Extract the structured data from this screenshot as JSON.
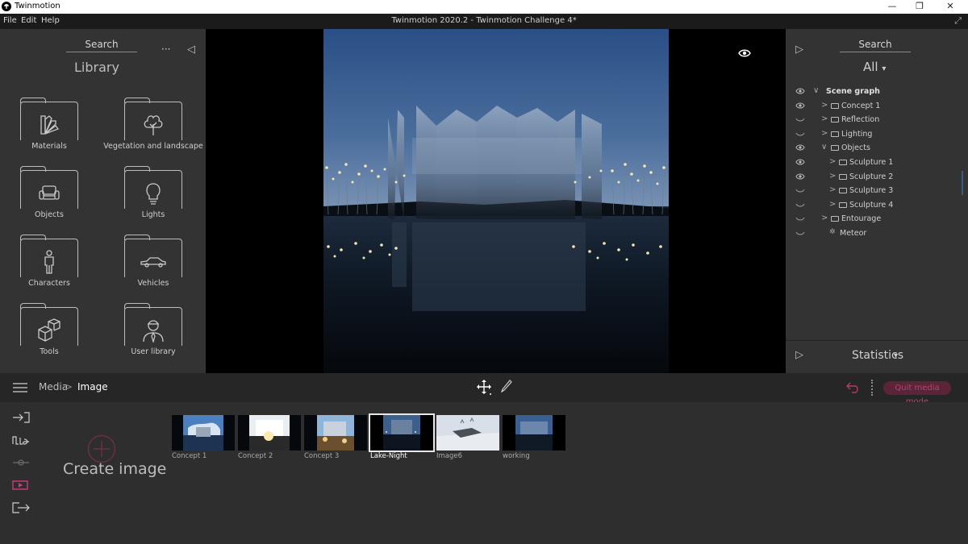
{
  "window": {
    "app_name": "Twinmotion",
    "document_title": "Twinmotion 2020.2 - Twinmotion Challenge 4*",
    "minimize_glyph": "—",
    "maximize_glyph": "❐",
    "close_glyph": "✕"
  },
  "menu": {
    "file": "File",
    "edit": "Edit",
    "help": "Help",
    "expand_glyph": "⤢"
  },
  "library": {
    "search_label": "Search",
    "heading": "Library",
    "more_glyph": "···",
    "collapse_glyph": "◁",
    "items": [
      {
        "label": "Materials",
        "icon": "materials-icon"
      },
      {
        "label": "Vegetation and landscape",
        "icon": "tree-icon"
      },
      {
        "label": "Objects",
        "icon": "sofa-icon"
      },
      {
        "label": "Lights",
        "icon": "lightbulb-icon"
      },
      {
        "label": "Characters",
        "icon": "person-icon"
      },
      {
        "label": "Vehicles",
        "icon": "car-icon"
      },
      {
        "label": "Tools",
        "icon": "cubes-icon"
      },
      {
        "label": "User library",
        "icon": "user-icon"
      }
    ]
  },
  "scene": {
    "expand_glyph": "▷",
    "search_label": "Search",
    "filter_value": "All",
    "filter_caret": "▾",
    "tree": [
      {
        "label": "Scene graph",
        "visible": true,
        "expanded": true,
        "folder": false
      },
      {
        "label": "Concept 1",
        "visible": true,
        "expanded": false,
        "folder": true
      },
      {
        "label": "Reflection",
        "visible": false,
        "expanded": false,
        "folder": true
      },
      {
        "label": "Lighting",
        "visible": false,
        "expanded": false,
        "folder": true
      },
      {
        "label": "Objects",
        "visible": true,
        "expanded": true,
        "folder": true
      },
      {
        "label": "Sculpture 1",
        "visible": true,
        "expanded": false,
        "folder": true
      },
      {
        "label": "Sculpture 2",
        "visible": true,
        "expanded": false,
        "folder": true
      },
      {
        "label": "Sculpture 3",
        "visible": false,
        "expanded": false,
        "folder": true
      },
      {
        "label": "Sculpture 4",
        "visible": false,
        "expanded": false,
        "folder": true
      },
      {
        "label": "Entourage",
        "visible": false,
        "expanded": false,
        "folder": true
      },
      {
        "label": "Meteor",
        "visible": false,
        "expanded": false,
        "folder": false
      }
    ],
    "statistics_label": "Statistics",
    "statistics_caret": "▾"
  },
  "toolbar": {
    "breadcrumb_root": "Media",
    "breadcrumb_separator": ">",
    "breadcrumb_current": "Image",
    "quit_label": "Quit media mode"
  },
  "media": {
    "create_label": "Create image",
    "thumbnails": [
      {
        "label": "Concept 1",
        "selected": false
      },
      {
        "label": "Concept 2",
        "selected": false
      },
      {
        "label": "Concept 3",
        "selected": false
      },
      {
        "label": "Lake-Night",
        "selected": true
      },
      {
        "label": "Image6",
        "selected": false
      },
      {
        "label": "working",
        "selected": false
      }
    ]
  },
  "colors": {
    "panel_bg": "#333333",
    "viewport_bg": "#000000",
    "accent_pink": "#d23a7a",
    "quit_bg": "#5b2438"
  }
}
